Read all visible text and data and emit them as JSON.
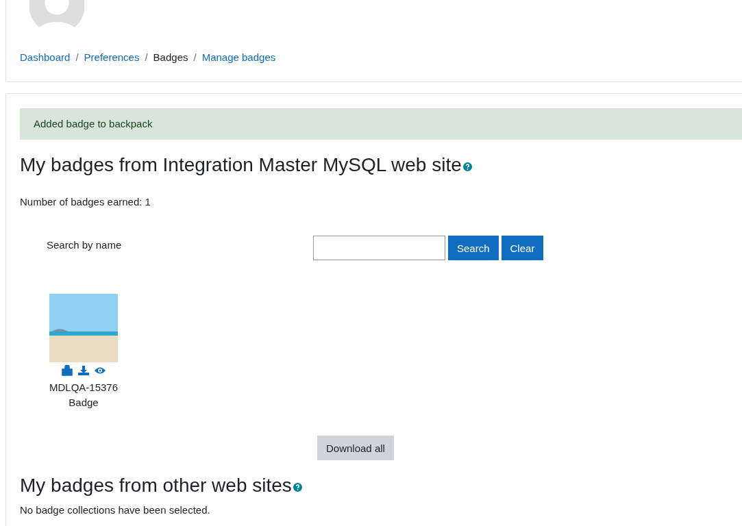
{
  "breadcrumb": {
    "separator": "/",
    "items": [
      {
        "label": "Dashboard",
        "current": false
      },
      {
        "label": "Preferences",
        "current": false
      },
      {
        "label": "Badges",
        "current": true
      },
      {
        "label": "Manage badges",
        "current": false
      }
    ]
  },
  "alert": {
    "text": "Added badge to backpack"
  },
  "site_section": {
    "heading": "My badges from Integration Master MySQL web site",
    "count_text": "Number of badges earned: 1",
    "search": {
      "label": "Search by name",
      "buttons": [
        "Search",
        "Clear"
      ]
    },
    "badges": [
      {
        "name": "MDLQA-15376 Badge"
      }
    ],
    "download_button": "Download all"
  },
  "other_section": {
    "heading": "My badges from other web sites",
    "text": "No badge collections have been selected."
  }
}
